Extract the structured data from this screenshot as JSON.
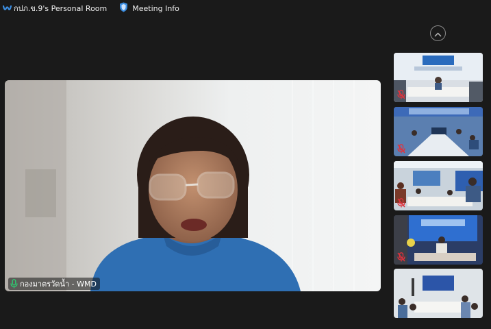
{
  "header": {
    "room_name": "กปภ.ข.9's Personal Room",
    "meeting_info_label": "Meeting Info"
  },
  "main_video": {
    "participant_name": "กองมาตรวัดน้ำ - WMD"
  },
  "colors": {
    "accent": "#3b8de0",
    "mic_active": "#2ecc71",
    "mic_muted": "#e0323c",
    "background": "#1a1a1a"
  },
  "icons": {
    "logo": "webex-logo-icon",
    "meeting_info": "shield-icon",
    "scroll": "chevron-up-icon",
    "mic": "microphone-icon",
    "mic_muted": "microphone-muted-icon"
  }
}
